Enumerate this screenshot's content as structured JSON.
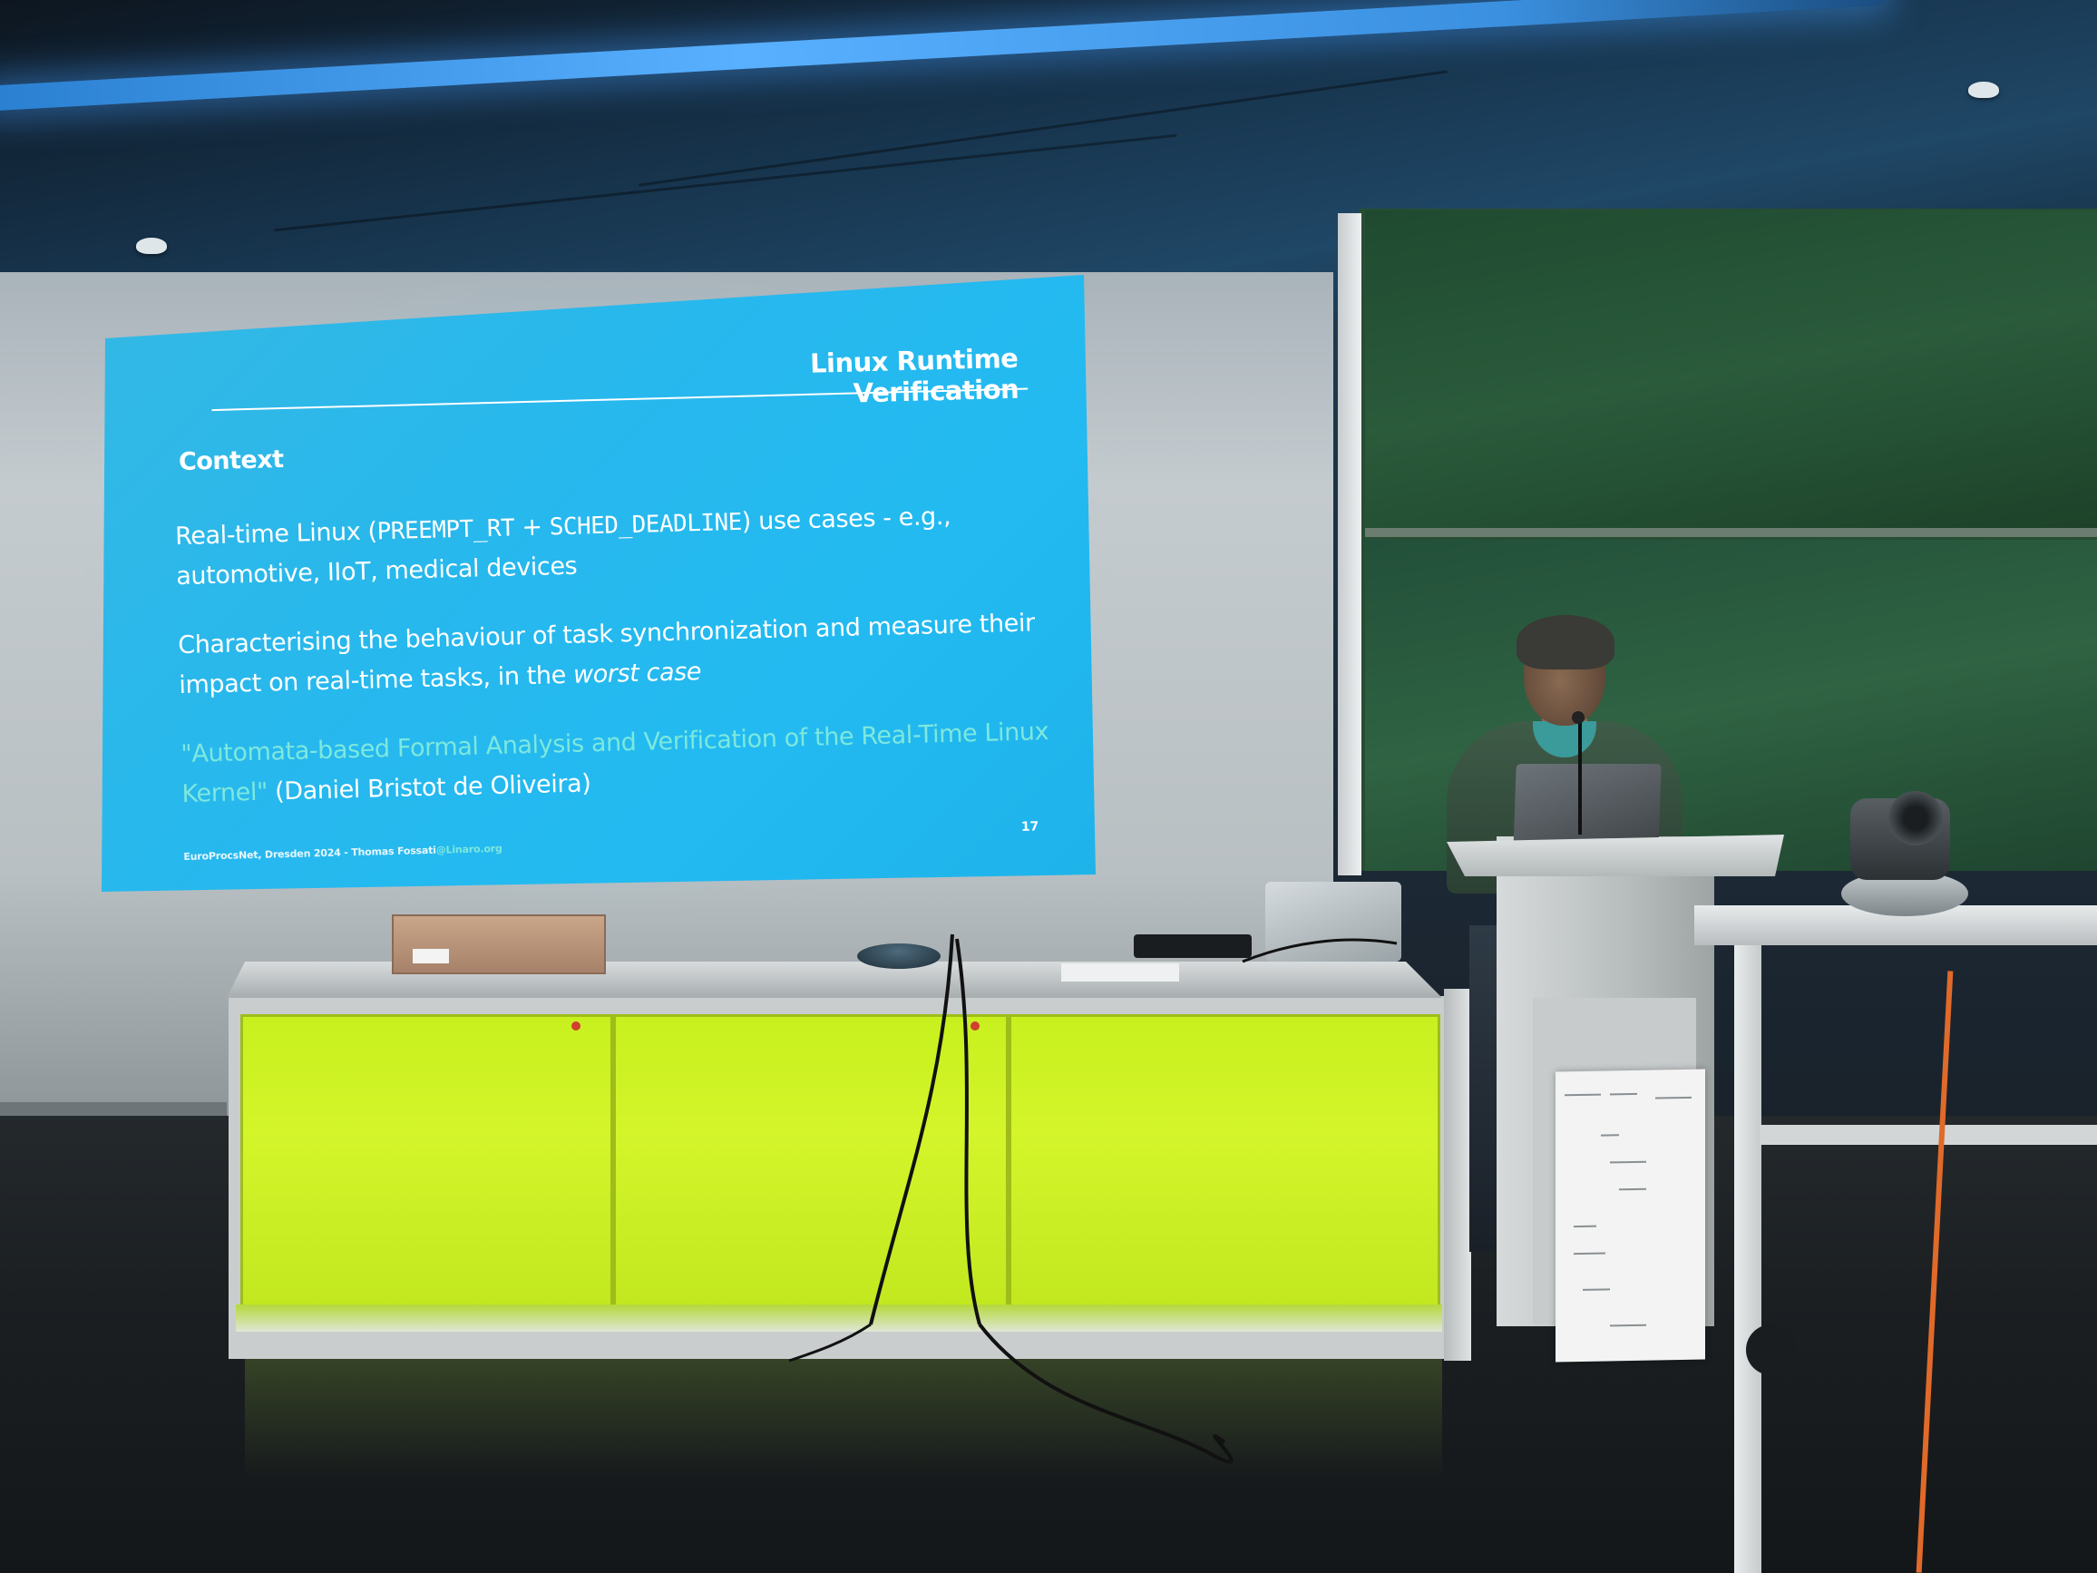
{
  "slide": {
    "title": "Linux Runtime Verification",
    "section": "Context",
    "bullet1_prefix": "Real-time Linux (",
    "bullet1_code1": "PREEMPT_RT",
    "bullet1_plus": " + ",
    "bullet1_code2": "SCHED_DEADLINE",
    "bullet1_suffix": ") use cases - e.g., automotive, IIoT, medical devices",
    "bullet2_text": "Characterising the behaviour of task synchronization and measure their impact on real-time tasks, in the ",
    "bullet2_emph": "worst case",
    "bullet3_link": "\"Automata-based Formal Analysis and Verification of the Real-Time Linux Kernel\"",
    "bullet3_author": " (Daniel Bristot de Oliveira)",
    "footer_text": "EuroProcsNet, Dresden 2024 - Thomas Fossati",
    "footer_link": "@Linaro.org",
    "page_number": "17"
  },
  "colors": {
    "slide_background": "#22baf1",
    "link_color": "#7de8de",
    "cabinet_green": "#c8f01e",
    "chalkboard": "#274d33"
  }
}
